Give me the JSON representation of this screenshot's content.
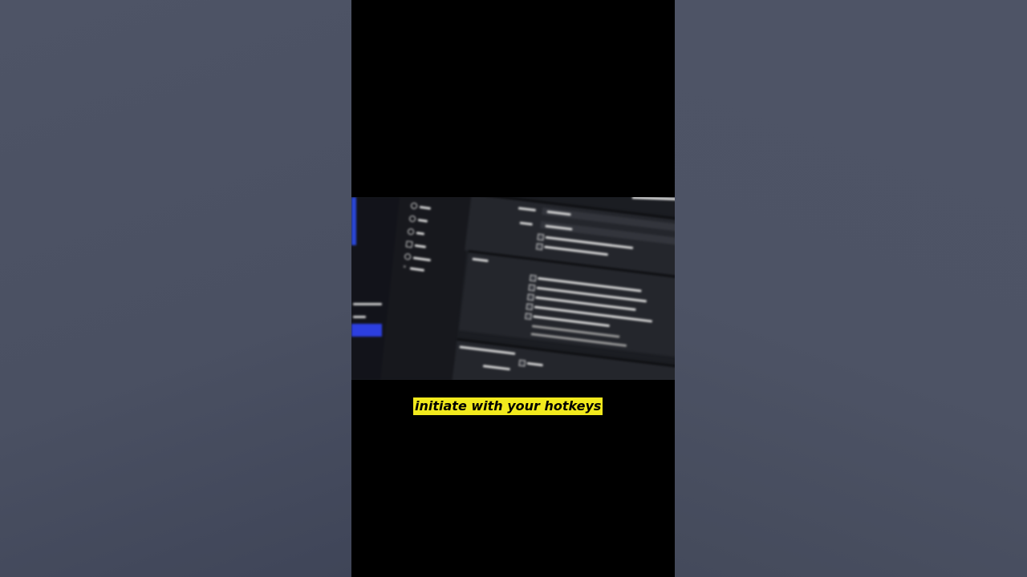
{
  "caption": {
    "text": "initiate with your hotkeys"
  },
  "colors": {
    "caption_bg": "#f2ea1d",
    "caption_text": "#000000",
    "video_bg": "#000000",
    "screen_dark": "#1b1d22",
    "accent_blue": "#2c3fe0",
    "side_background": "#4b5163"
  }
}
